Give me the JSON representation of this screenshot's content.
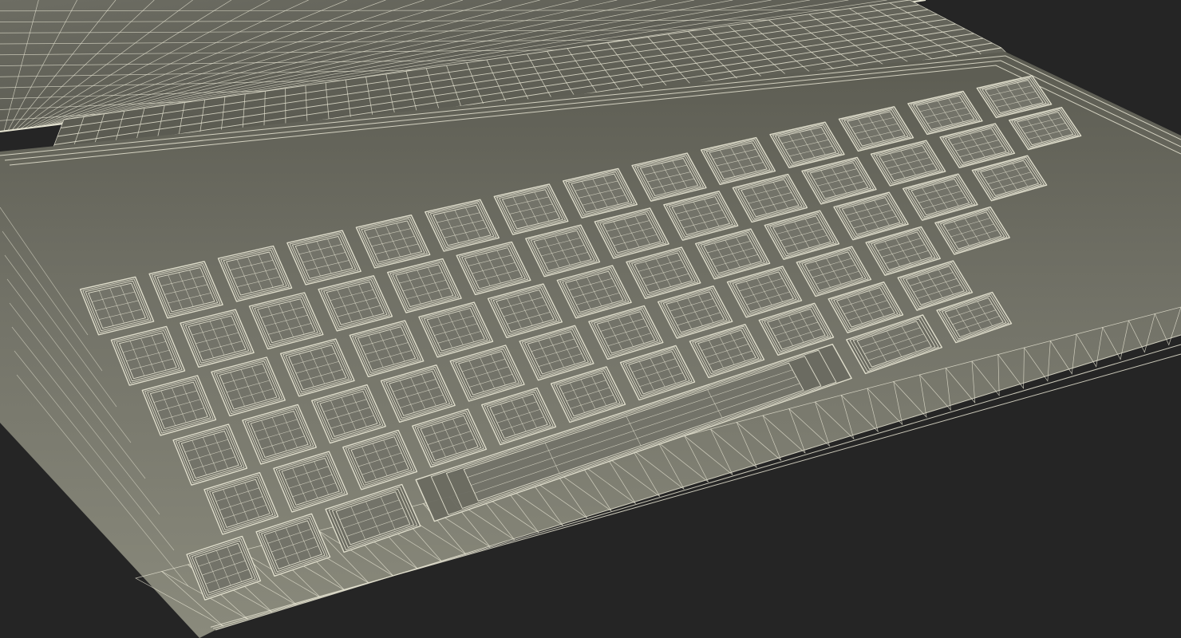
{
  "scene": {
    "subject": "keyboard-cover-wireframe",
    "colors": {
      "background": "#252525",
      "surface_light": "#868677",
      "surface_dark": "#535349",
      "wire": "#e6e4d2",
      "key_face": "#74746a"
    },
    "keyboard": {
      "rows": [
        14,
        14,
        13,
        12,
        11
      ],
      "has_space_bar": true,
      "hinge_strips": 2
    },
    "lid_visible": true
  }
}
